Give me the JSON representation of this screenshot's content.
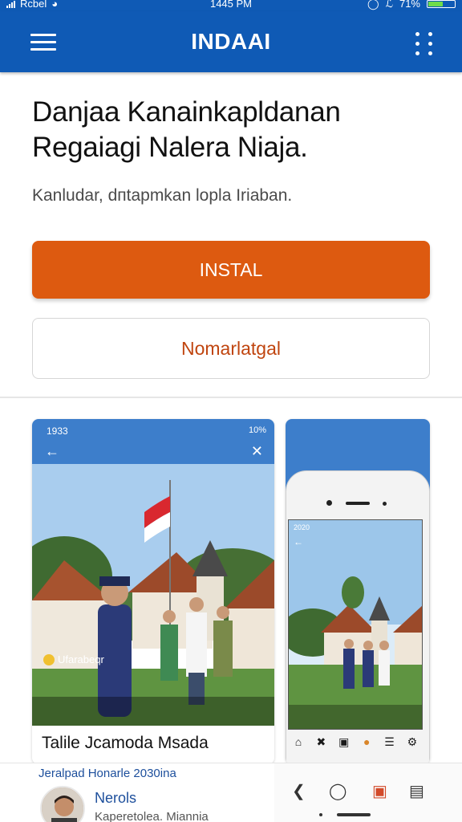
{
  "status_bar": {
    "carrier": "Rcbel",
    "time": "1445 PM",
    "battery_text": "71%"
  },
  "app_bar": {
    "title": "INDAAI",
    "menu_icon": "hamburger-icon",
    "more_icon": "kebab-menu-icon",
    "color": "#0f5ab5"
  },
  "main": {
    "headline": "Danjaa Kanainkapldanan Regaiagi Nalera Niaja.",
    "subtitle": "Kanludar, dпtapmkan lopla Iriaban.",
    "install_label": "INSTAL",
    "secondary_label": "Nomarlatgal",
    "install_color": "#dd5a10"
  },
  "screenshots": [
    {
      "time": "1933",
      "status": "10%",
      "chip_label": "Ufarabeqr",
      "title": "Talile Jcamoda Msada"
    },
    {
      "time": "2020"
    }
  ],
  "bottom_panel": {
    "line1": "Jeralpad Honarle 2030ina",
    "name": "Nerols",
    "sub": "Kaperetolea. Miannia"
  },
  "nav_bar": {
    "back_icon": "back-icon",
    "home_icon": "home-icon",
    "app_icon": "app-icon",
    "recent_icon": "recent-apps-icon"
  }
}
